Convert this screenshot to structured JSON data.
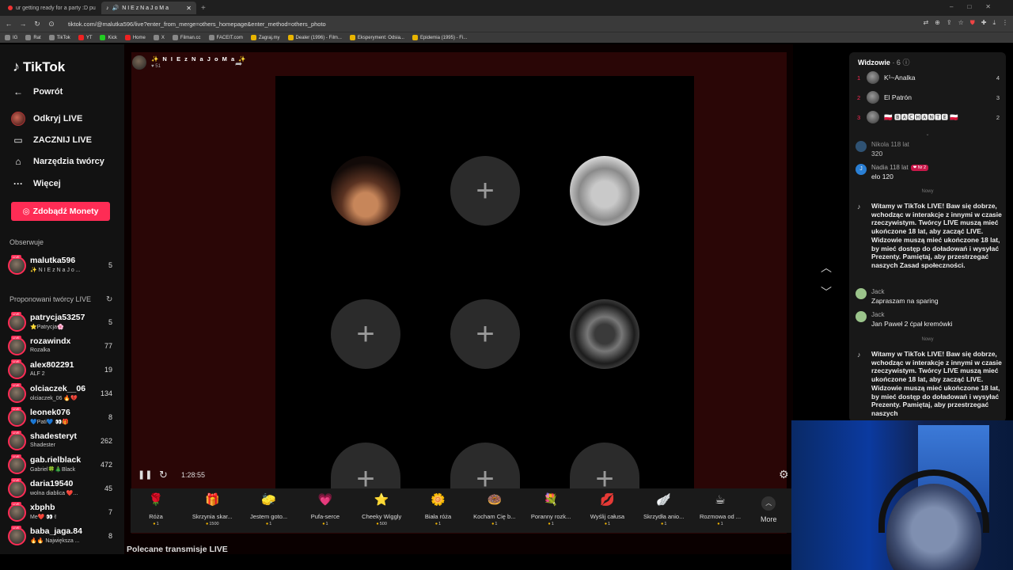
{
  "browser": {
    "tabs": [
      {
        "title": "ur getting ready for a party :D pu",
        "active": false
      },
      {
        "title": "N I E z N a J o M a",
        "active": true
      }
    ],
    "url": "tiktok.com/@malutka596/live?enter_from_merge=others_homepage&enter_method=others_photo",
    "bookmarks": [
      "IG",
      "Rat",
      "TikTok",
      "YT",
      "Kick",
      "Home",
      "X",
      "Filman.cc",
      "FACEIT.com",
      "Zagraj.my",
      "Dealer (1996) - Film...",
      "Eksperyment: Odsia...",
      "Epidemia (1995) - Fi..."
    ]
  },
  "sidebar": {
    "logo": "TikTok",
    "back": "Powrót",
    "menu": [
      {
        "label": "Odkryj LIVE",
        "icon": "live-avatar-icon"
      },
      {
        "label": "ZACZNIJ LIVE",
        "icon": "camera-icon"
      },
      {
        "label": "Narzędzia twórcy",
        "icon": "home-icon"
      },
      {
        "label": "Więcej",
        "icon": "more-dots-icon"
      }
    ],
    "coins_button": "Zdobądź Monety",
    "following_label": "Obserwuje",
    "following": [
      {
        "name": "malutka596",
        "sub": "✨ N I E z N a J o ...",
        "count": "5"
      }
    ],
    "suggested_label": "Proponowani twórcy LIVE",
    "suggested": [
      {
        "name": "patrycja53257",
        "sub": "⭐Patrycja🌸",
        "count": "5"
      },
      {
        "name": "rozawindx",
        "sub": "Rozalka",
        "count": "77"
      },
      {
        "name": "alex802291",
        "sub": "ALF 2",
        "count": "19"
      },
      {
        "name": "olciaczek__06",
        "sub": "olciaczek_06 🔥💔",
        "count": "134"
      },
      {
        "name": "leonek076",
        "sub": "💙Pati💙 👀🎁",
        "count": "8"
      },
      {
        "name": "shadesteryt",
        "sub": "Shadester",
        "count": "262"
      },
      {
        "name": "gab.rielblack",
        "sub": "Gabriel🍀🎄Black",
        "count": "472"
      },
      {
        "name": "daria19540",
        "sub": "wolna diablica ❤️...",
        "count": "45"
      },
      {
        "name": "xbphb",
        "sub": "Me❤️ 👀✌",
        "count": "7"
      },
      {
        "name": "baba_jaga.84",
        "sub": "🔥🔥 Największa ...",
        "count": "8"
      }
    ]
  },
  "stage": {
    "host_name": "✨ N I E z N a J o M a ✨",
    "host_likes": "51",
    "timer": "1:28:55",
    "recommended_label": "Polecane transmisje LIVE"
  },
  "gifts": [
    {
      "name": "Róża",
      "price": "1",
      "icon": "🌹"
    },
    {
      "name": "Skrzynia skar...",
      "price": "1500",
      "icon": "🎁"
    },
    {
      "name": "Jestem goto...",
      "price": "1",
      "icon": "🧽"
    },
    {
      "name": "Pufa-serce",
      "price": "1",
      "icon": "💗"
    },
    {
      "name": "Cheeky Wiggly",
      "price": "500",
      "icon": "⭐"
    },
    {
      "name": "Biała róża",
      "price": "1",
      "icon": "🌼"
    },
    {
      "name": "Kocham Cię b...",
      "price": "1",
      "icon": "🍩"
    },
    {
      "name": "Poranny rozk...",
      "price": "1",
      "icon": "💐"
    },
    {
      "name": "Wyślij całusa",
      "price": "1",
      "icon": "💋"
    },
    {
      "name": "Skrzydła anio...",
      "price": "1",
      "icon": "🪽"
    },
    {
      "name": "Rozmowa od ...",
      "price": "1",
      "icon": "☕"
    }
  ],
  "more_label": "More",
  "panel": {
    "viewers_title": "Widzowie",
    "viewers_count": "· 6",
    "viewers": [
      {
        "rank": "1",
        "name": "K¹~Analka",
        "score": "4"
      },
      {
        "rank": "2",
        "name": "El Patrón",
        "score": "3"
      },
      {
        "rank": "3",
        "name": "🇵🇱 🅱🅰🅲🅷🅰🅽🆃🅴 🇵🇱",
        "score": "2"
      }
    ],
    "chat_top": [
      {
        "user": "Nikola 118 lat",
        "text": "320",
        "badge": ""
      },
      {
        "user": "Nadia 118 lat",
        "text": "elo 120",
        "badge": "❤ Nr 2"
      }
    ],
    "divider": "Nowy",
    "system_msg": "Witamy w TikTok LIVE! Baw się dobrze, wchodząc w interakcje z innymi w czasie rzeczywistym. Twórcy LIVE muszą mieć ukończone 18 lat, aby zacząć LIVE. Widzowie muszą mieć ukończone 18 lat, by mieć dostęp do doładowań i wysyłać Prezenty. Pamiętaj, aby przestrzegać naszych Zasad społeczności.",
    "chat_mid": [
      {
        "user": "Jack",
        "text": "Zapraszam na sparing"
      },
      {
        "user": "Jack",
        "text": "Jan Paweł 2 ćpał kremówki"
      }
    ],
    "divider2": "Nowy",
    "system_msg2": "Witamy w TikTok LIVE! Baw się dobrze, wchodząc w interakcje z innymi w czasie rzeczywistym. Twórcy LIVE muszą mieć ukończone 18 lat, aby zacząć LIVE. Widzowie muszą mieć ukończone 18 lat, by mieć dostęp do doładowań i wysyłać Prezenty. Pamiętaj, aby przestrzegać naszych"
  }
}
